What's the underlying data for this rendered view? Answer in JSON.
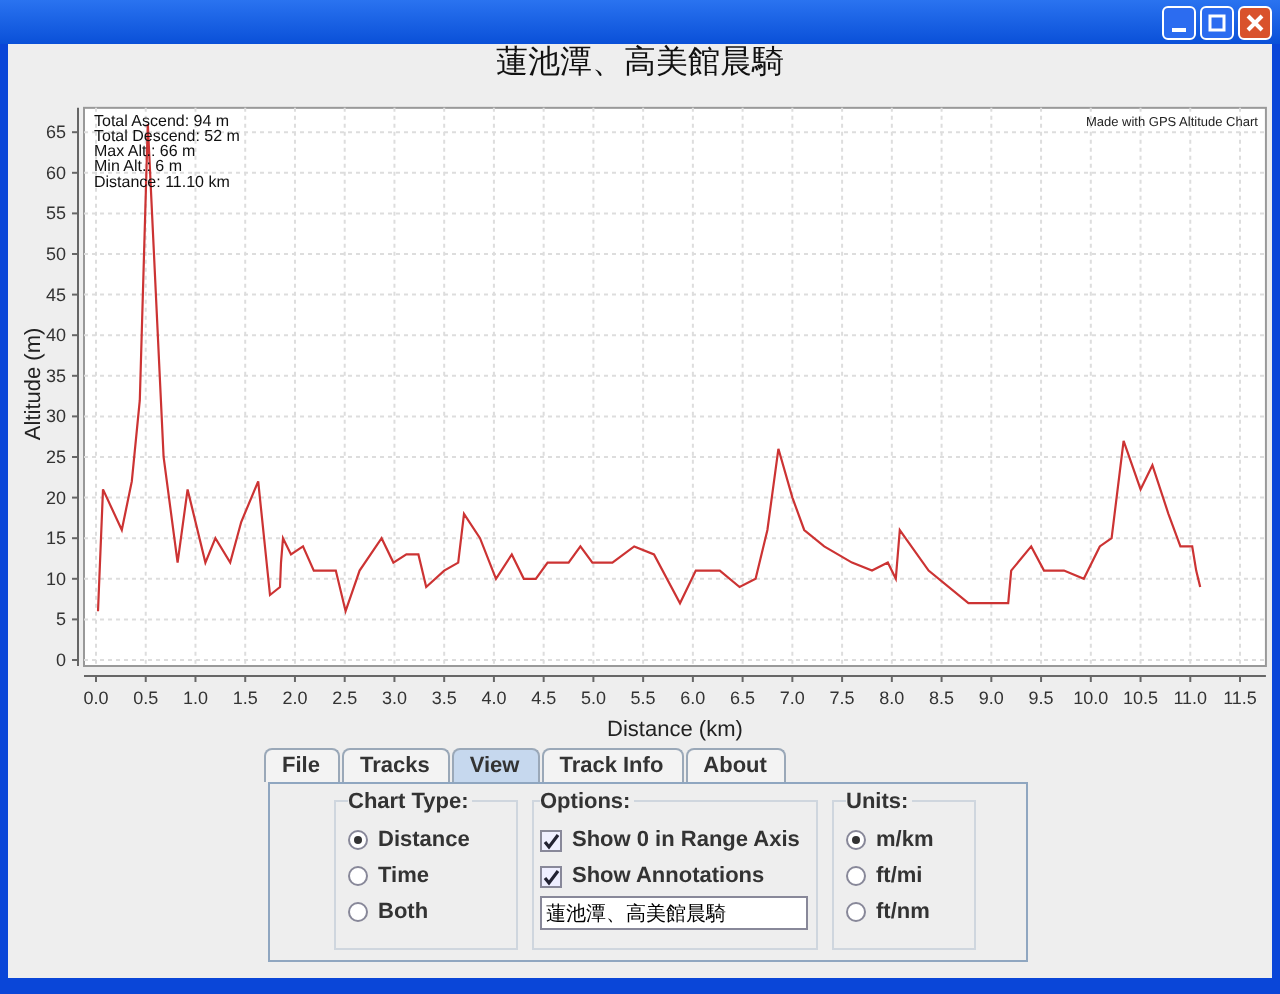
{
  "chart": {
    "chart_data": {
      "type": "line",
      "title": "蓮池潭、高美館晨騎",
      "xlabel": "Distance (km)",
      "ylabel": "Altitude (m)",
      "xlim": [
        0,
        11.7
      ],
      "ylim": [
        0,
        68
      ],
      "xticks": [
        {
          "value": 0,
          "label": "0.0"
        },
        {
          "value": 0.5,
          "label": "0.5"
        },
        {
          "value": 1,
          "label": "1.0"
        },
        {
          "value": 1.5,
          "label": "1.5"
        },
        {
          "value": 2,
          "label": "2.0"
        },
        {
          "value": 2.5,
          "label": "2.5"
        },
        {
          "value": 3,
          "label": "3.0"
        },
        {
          "value": 3.5,
          "label": "3.5"
        },
        {
          "value": 4,
          "label": "4.0"
        },
        {
          "value": 4.5,
          "label": "4.5"
        },
        {
          "value": 5,
          "label": "5.0"
        },
        {
          "value": 5.5,
          "label": "5.5"
        },
        {
          "value": 6,
          "label": "6.0"
        },
        {
          "value": 6.5,
          "label": "6.5"
        },
        {
          "value": 7,
          "label": "7.0"
        },
        {
          "value": 7.5,
          "label": "7.5"
        },
        {
          "value": 8,
          "label": "8.0"
        },
        {
          "value": 8.5,
          "label": "8.5"
        },
        {
          "value": 9,
          "label": "9.0"
        },
        {
          "value": 9.5,
          "label": "9.5"
        },
        {
          "value": 10,
          "label": "10.0"
        },
        {
          "value": 10.5,
          "label": "10.5"
        },
        {
          "value": 11,
          "label": "11.0"
        },
        {
          "value": 11.5,
          "label": "11.5"
        }
      ],
      "yticks": [
        0,
        5,
        10,
        15,
        20,
        25,
        30,
        35,
        40,
        45,
        50,
        55,
        60,
        65
      ],
      "x": [
        0.02,
        0.07,
        0.26,
        0.36,
        0.44,
        0.52,
        0.68,
        0.82,
        0.92,
        1.1,
        1.2,
        1.35,
        1.46,
        1.63,
        1.75,
        1.85,
        1.86,
        1.88,
        1.96,
        2.08,
        2.19,
        2.41,
        2.51,
        2.65,
        2.87,
        2.99,
        3.12,
        3.24,
        3.32,
        3.5,
        3.64,
        3.7,
        3.86,
        4.02,
        4.18,
        4.3,
        4.42,
        4.54,
        4.75,
        4.87,
        4.99,
        5.19,
        5.41,
        5.61,
        5.87,
        6.03,
        6.27,
        6.47,
        6.63,
        6.75,
        6.86,
        7.0,
        7.12,
        7.32,
        7.6,
        7.8,
        7.96,
        8.04,
        8.08,
        8.37,
        8.77,
        9.17,
        9.2,
        9.4,
        9.53,
        9.73,
        9.93,
        10.09,
        10.21,
        10.33,
        10.5,
        10.62,
        10.78,
        10.9,
        11.02,
        11.06,
        11.1
      ],
      "grid": true,
      "series": [
        {
          "color": "#cc3333",
          "values": [
            6,
            21,
            16,
            22,
            32,
            66,
            25,
            12,
            21,
            12,
            15,
            12,
            17,
            22,
            8,
            9,
            12,
            15,
            13,
            14,
            11,
            11,
            6,
            11,
            15,
            12,
            13,
            13,
            9,
            11,
            12,
            18,
            15,
            10,
            13,
            10,
            10,
            12,
            12,
            14,
            12,
            12,
            14,
            13,
            7,
            11,
            11,
            9,
            10,
            16,
            26,
            20,
            16,
            14,
            12,
            11,
            12,
            10,
            16,
            11,
            7,
            7,
            11,
            14,
            11,
            11,
            10,
            14,
            15,
            27,
            21,
            24,
            18,
            14,
            14,
            11,
            9
          ]
        }
      ],
      "annotations": [
        "Total Ascend: 94 m",
        "Total Descend: 52 m",
        "Max Alt.: 66 m",
        "Min Alt.: 6 m",
        "Distance: 11.10 km",
        "Made with GPS Altitude Chart"
      ]
    }
  },
  "tabs": [
    {
      "label": "File",
      "selected": false
    },
    {
      "label": "Tracks",
      "selected": false
    },
    {
      "label": "View",
      "selected": true
    },
    {
      "label": "Track Info",
      "selected": false
    },
    {
      "label": "About",
      "selected": false
    }
  ],
  "chart_type": {
    "legend": "Chart Type:",
    "options": [
      {
        "label": "Distance",
        "selected": true
      },
      {
        "label": "Time",
        "selected": false
      },
      {
        "label": "Both",
        "selected": false
      }
    ]
  },
  "options": {
    "legend": "Options:",
    "items": [
      {
        "label": "Show 0 in Range Axis",
        "checked": true
      },
      {
        "label": "Show Annotations",
        "checked": true
      }
    ],
    "title_field": {
      "value": "蓮池潭、高美館晨騎"
    }
  },
  "units": {
    "legend": "Units:",
    "options": [
      {
        "label": "m/km",
        "selected": true
      },
      {
        "label": "ft/mi",
        "selected": false
      },
      {
        "label": "ft/nm",
        "selected": false
      }
    ]
  }
}
